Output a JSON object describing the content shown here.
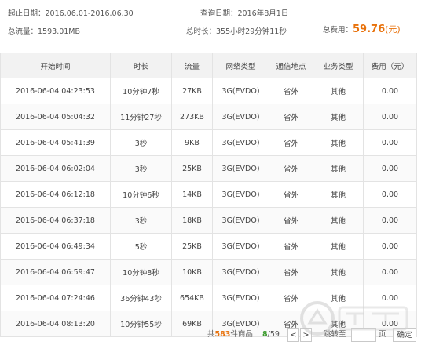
{
  "summary": {
    "period_label": "起止日期：",
    "period_value": "2016.06.01-2016.06.30",
    "query_date_label": "查询日期：",
    "query_date_value": "2016年8月1日",
    "total_traffic_label": "总流量：",
    "total_traffic_value": "1593.01MB",
    "total_duration_label": "总时长：",
    "total_duration_value": "355小时29分钟11秒",
    "total_fee_label": "总费用：",
    "total_fee_value": "59.76",
    "total_fee_unit": "(元)"
  },
  "table": {
    "headers": [
      "开始时间",
      "时长",
      "流量",
      "网络类型",
      "通信地点",
      "业务类型",
      "费用（元）"
    ],
    "rows": [
      [
        "2016-06-04 04:23:53",
        "10分钟7秒",
        "27KB",
        "3G(EVDO)",
        "省外",
        "其他",
        "0.00"
      ],
      [
        "2016-06-04 05:04:32",
        "11分钟27秒",
        "273KB",
        "3G(EVDO)",
        "省外",
        "其他",
        "0.00"
      ],
      [
        "2016-06-04 05:41:39",
        "3秒",
        "9KB",
        "3G(EVDO)",
        "省外",
        "其他",
        "0.00"
      ],
      [
        "2016-06-04 06:02:04",
        "3秒",
        "25KB",
        "3G(EVDO)",
        "省外",
        "其他",
        "0.00"
      ],
      [
        "2016-06-04 06:12:18",
        "10分钟6秒",
        "14KB",
        "3G(EVDO)",
        "省外",
        "其他",
        "0.00"
      ],
      [
        "2016-06-04 06:37:18",
        "3秒",
        "18KB",
        "3G(EVDO)",
        "省外",
        "其他",
        "0.00"
      ],
      [
        "2016-06-04 06:49:34",
        "5秒",
        "25KB",
        "3G(EVDO)",
        "省外",
        "其他",
        "0.00"
      ],
      [
        "2016-06-04 06:59:47",
        "10分钟8秒",
        "10KB",
        "3G(EVDO)",
        "省外",
        "其他",
        "0.00"
      ],
      [
        "2016-06-04 07:24:46",
        "36分钟43秒",
        "654KB",
        "3G(EVDO)",
        "省外",
        "其他",
        "0.00"
      ],
      [
        "2016-06-04 08:13:20",
        "10分钟55秒",
        "69KB",
        "3G(EVDO)",
        "省外",
        "其他",
        "0.00"
      ]
    ]
  },
  "pager": {
    "total_prefix": "共",
    "total_count": "583",
    "total_suffix": "件商品",
    "current_page": "8",
    "page_sep": "/",
    "total_pages": "59",
    "prev_label": "<",
    "next_label": ">",
    "jump_label": "跳转至",
    "page_unit": "页",
    "confirm_label": "确定"
  },
  "colors": {
    "accent_orange": "#e8720c",
    "page_green": "#3a9a2c",
    "header_bg": "#f2f2f2",
    "border": "#e3e3e3"
  },
  "icons": {
    "prev": "chevron-left-icon",
    "next": "chevron-right-icon",
    "watermark": "watermark-logo-icon"
  }
}
